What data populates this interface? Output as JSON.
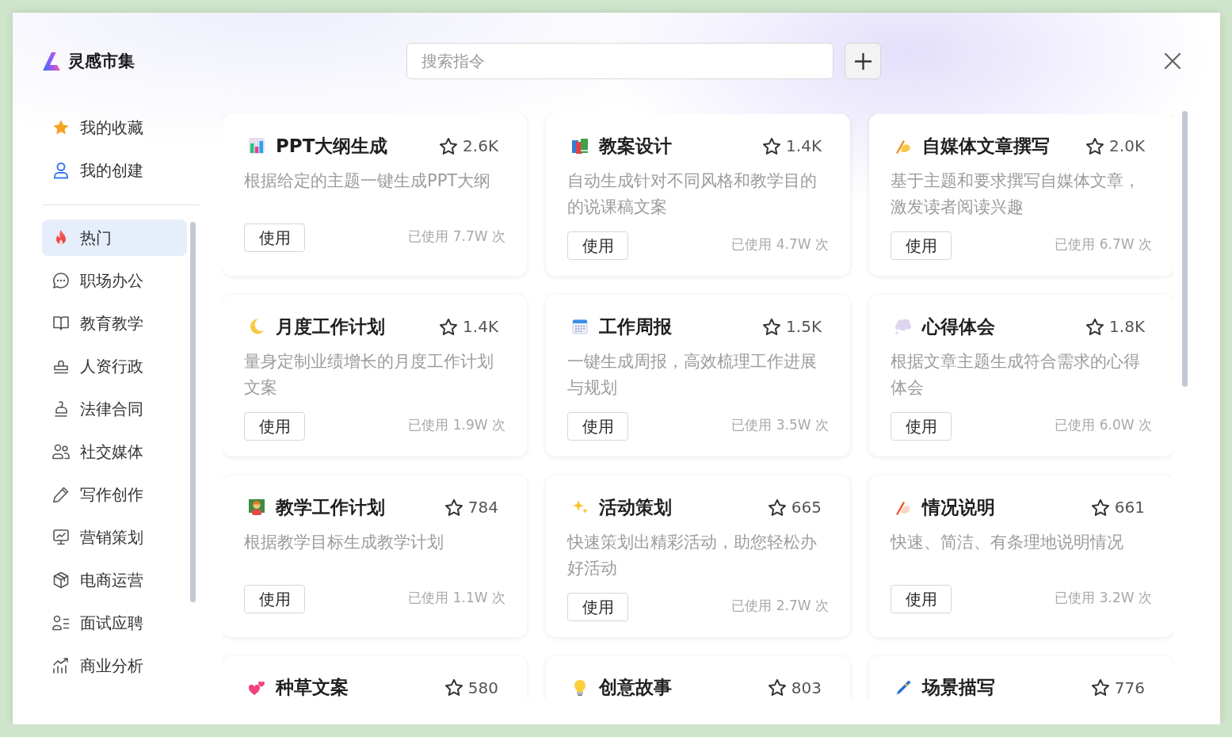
{
  "window": {
    "title": "灵感市集"
  },
  "search": {
    "placeholder": "搜索指令"
  },
  "sidebar": {
    "shortcuts": [
      {
        "label": "我的收藏",
        "selected": false
      },
      {
        "label": "我的创建",
        "selected": false
      }
    ],
    "categories": [
      {
        "label": "热门",
        "selected": true
      },
      {
        "label": "职场办公",
        "selected": false
      },
      {
        "label": "教育教学",
        "selected": false
      },
      {
        "label": "人资行政",
        "selected": false
      },
      {
        "label": "法律合同",
        "selected": false
      },
      {
        "label": "社交媒体",
        "selected": false
      },
      {
        "label": "写作创作",
        "selected": false
      },
      {
        "label": "营销策划",
        "selected": false
      },
      {
        "label": "电商运营",
        "selected": false
      },
      {
        "label": "面试应聘",
        "selected": false
      },
      {
        "label": "商业分析",
        "selected": false
      }
    ]
  },
  "cards": [
    {
      "title": "PPT大纲生成",
      "favorites": "2.6K",
      "description": "根据给定的主题一键生成PPT大纲",
      "button": "使用",
      "usage": "已使用 7.7W 次"
    },
    {
      "title": "教案设计",
      "favorites": "1.4K",
      "description": "自动生成针对不同风格和教学目的的说课稿文案",
      "button": "使用",
      "usage": "已使用 4.7W 次"
    },
    {
      "title": "自媒体文章撰写",
      "favorites": "2.0K",
      "description": "基于主题和要求撰写自媒体文章，激发读者阅读兴趣",
      "button": "使用",
      "usage": "已使用 6.7W 次"
    },
    {
      "title": "月度工作计划",
      "favorites": "1.4K",
      "description": "量身定制业绩增长的月度工作计划文案",
      "button": "使用",
      "usage": "已使用 1.9W 次"
    },
    {
      "title": "工作周报",
      "favorites": "1.5K",
      "description": "一键生成周报，高效梳理工作进展与规划",
      "button": "使用",
      "usage": "已使用 3.5W 次"
    },
    {
      "title": "心得体会",
      "favorites": "1.8K",
      "description": "根据文章主题生成符合需求的心得体会",
      "button": "使用",
      "usage": "已使用 6.0W 次"
    },
    {
      "title": "教学工作计划",
      "favorites": "784",
      "description": "根据教学目标生成教学计划",
      "button": "使用",
      "usage": "已使用 1.1W 次"
    },
    {
      "title": "活动策划",
      "favorites": "665",
      "description": "快速策划出精彩活动，助您轻松办好活动",
      "button": "使用",
      "usage": "已使用 2.7W 次"
    },
    {
      "title": "情况说明",
      "favorites": "661",
      "description": "快速、简洁、有条理地说明情况",
      "button": "使用",
      "usage": "已使用 3.2W 次"
    },
    {
      "title": "种草文案",
      "favorites": "580"
    },
    {
      "title": "创意故事",
      "favorites": "803"
    },
    {
      "title": "场景描写",
      "favorites": "776"
    }
  ]
}
